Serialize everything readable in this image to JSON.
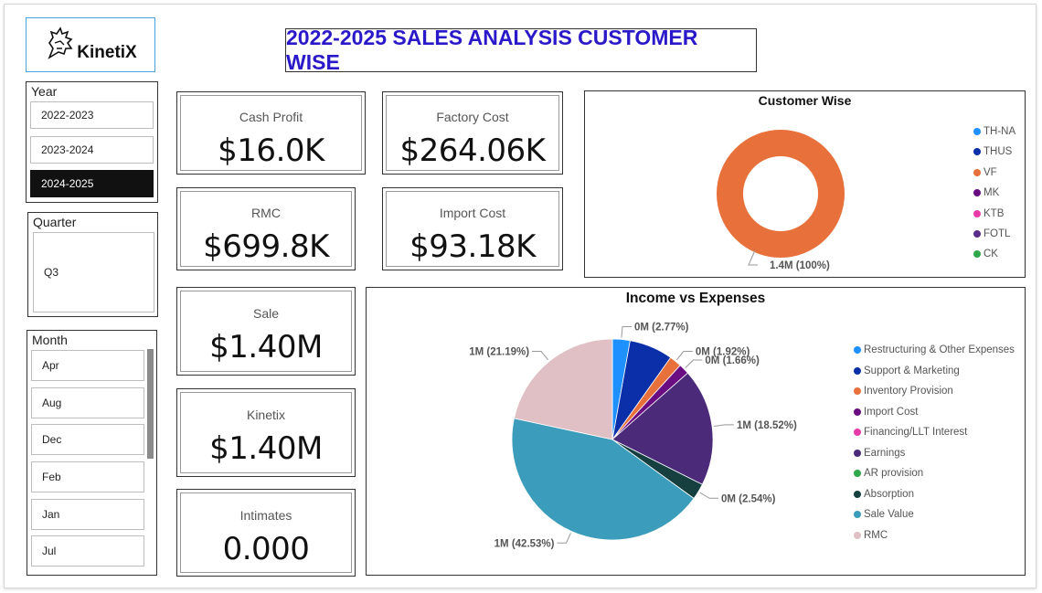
{
  "logo": {
    "text": "KinetiX"
  },
  "title": "2022-2025 SALES ANALYSIS CUSTOMER WISE",
  "year_slicer": {
    "title": "Year",
    "items": [
      {
        "label": "2022-2023",
        "selected": false
      },
      {
        "label": "2023-2024",
        "selected": false
      },
      {
        "label": "2024-2025",
        "selected": true
      }
    ]
  },
  "quarter_slicer": {
    "title": "Quarter",
    "items": [
      {
        "label": "Q3"
      }
    ]
  },
  "month_slicer": {
    "title": "Month",
    "items": [
      {
        "label": "Apr"
      },
      {
        "label": "Aug"
      },
      {
        "label": "Dec"
      },
      {
        "label": "Feb"
      },
      {
        "label": "Jan"
      },
      {
        "label": "Jul"
      }
    ]
  },
  "kpis": {
    "cash_profit": {
      "label": "Cash Profit",
      "value": "$16.0K"
    },
    "factory_cost": {
      "label": "Factory Cost",
      "value": "$264.06K"
    },
    "rmc": {
      "label": "RMC",
      "value": "$699.8K"
    },
    "import_cost": {
      "label": "Import Cost",
      "value": "$93.18K"
    },
    "sale": {
      "label": "Sale",
      "value": "$1.40M"
    },
    "kinetix": {
      "label": "Kinetix",
      "value": "$1.40M"
    },
    "intimates": {
      "label": "Intimates",
      "value": "0.000"
    }
  },
  "chart_data": [
    {
      "type": "pie",
      "title": "Customer Wise",
      "categories": [
        "TH-NA",
        "THUS",
        "VF",
        "MK",
        "KTB",
        "FOTL",
        "CK"
      ],
      "colors": [
        "#1e90ff",
        "#0a2fa8",
        "#e8703a",
        "#6a0d83",
        "#e83aa8",
        "#5a2d8a",
        "#2ea84a"
      ],
      "values": [
        0,
        0,
        1.4,
        0,
        0,
        0,
        0
      ],
      "data_labels": [
        "",
        "",
        "1.4M (100%)",
        "",
        "",
        "",
        ""
      ],
      "donut": true,
      "legend": "right"
    },
    {
      "type": "pie",
      "title": "Income vs Expenses",
      "categories": [
        "Restructuring & Other Expenses",
        "Support & Marketing",
        "Inventory Provision",
        "Import Cost",
        "Financing/LLT Interest",
        "Earnings",
        "AR provision",
        "Absorption",
        "Sale Value",
        "RMC"
      ],
      "colors": [
        "#1e90ff",
        "#0a2fa8",
        "#e8703a",
        "#6a0d83",
        "#e83aa8",
        "#4b2a7a",
        "#2ea84a",
        "#163f3f",
        "#3b9dbb",
        "#e0c0c4"
      ],
      "values": [
        2.77,
        6.86,
        1.92,
        1.66,
        0,
        18.52,
        0,
        2.54,
        42.53,
        21.19
      ],
      "data_labels": [
        "0M (2.77%)",
        "",
        "0M (1.92%)",
        "0M (1.66%)",
        "",
        "1M (18.52%)",
        "",
        "0M (2.54%)",
        "1M (42.53%)",
        "1M (21.19%)"
      ],
      "legend": "right"
    }
  ]
}
